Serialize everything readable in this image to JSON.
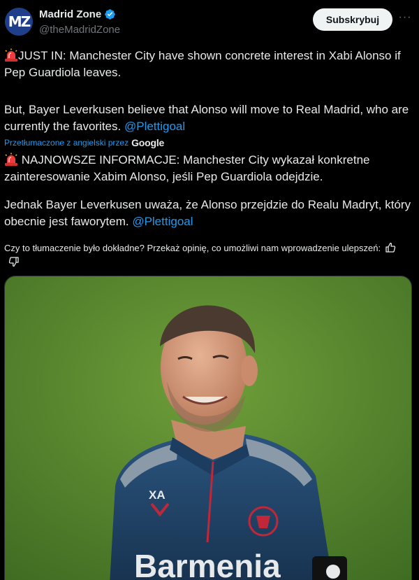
{
  "account": {
    "avatar_text": "MZ",
    "display_name": "Madrid Zone",
    "handle": "@theMadridZone"
  },
  "header": {
    "subscribe_label": "Subskrybuj",
    "more_label": "···"
  },
  "tweet": {
    "original_line1": "JUST IN: Manchester City have shown concrete interest in Xabi Alonso if Pep Guardiola leaves.",
    "original_line2": "But, Bayer Leverkusen believe that Alonso will move to Real Madrid, who are currently the favorites. ",
    "original_mention": "@Plettigoal",
    "translated_by_label": "Przetłumaczone z angielski przez",
    "translated_by_brand": "Google",
    "translated_line1": " NAJNOWSZE INFORMACJE: Manchester City wykazał konkretne zainteresowanie Xabim Alonso, jeśli Pep Guardiola odejdzie.",
    "translated_line2": "Jednak Bayer Leverkusen uważa, że Alonso przejdzie do Realu Madryt, który obecnie jest faworytem. ",
    "translated_mention": "@Plettigoal"
  },
  "feedback": {
    "prompt": "Czy to tłumaczenie było dokładne? Przekaż opinię, co umożliwi nam wprowadzenie ulepszeń:"
  },
  "photo": {
    "shirt_initials": "XA",
    "sponsor_text": "Barmenia"
  },
  "colors": {
    "background": "#000000",
    "text": "#e7e9ea",
    "muted": "#71767b",
    "link": "#1d9bf0",
    "verified": "#1d9bf0",
    "pitch_green": "#5f8f2f",
    "shirt_navy": "#1d3b5e"
  }
}
